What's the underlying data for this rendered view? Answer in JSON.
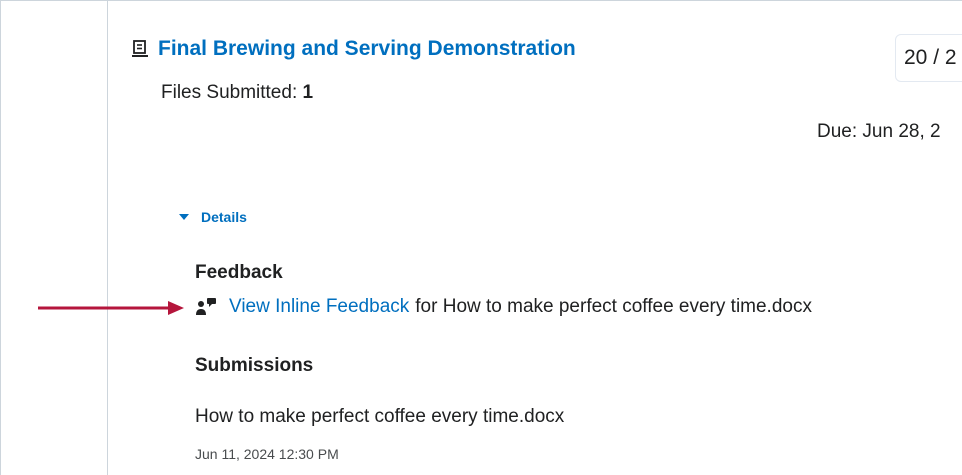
{
  "assignment": {
    "title": "Final Brewing and Serving Demonstration",
    "files_label": "Files Submitted: ",
    "files_count": "1",
    "score": "20 / 2",
    "due": "Due: Jun 28, 2"
  },
  "details": {
    "toggle_label": "Details",
    "feedback_heading": "Feedback",
    "feedback_link": "View Inline Feedback",
    "feedback_rest": "for How to make perfect coffee every time.docx",
    "submissions_heading": "Submissions",
    "submission_file": "How to make perfect coffee every time.docx",
    "submission_date": "Jun 11, 2024 12:30 PM"
  },
  "icons": {
    "title_icon": "assignment-icon",
    "feedback_icon": "inline-feedback-icon",
    "toggle_icon": "caret-down-icon",
    "annotation": "red-arrow-icon"
  },
  "colors": {
    "link": "#006fbf",
    "arrow": "#b5163c",
    "border": "#cdd5dc"
  }
}
